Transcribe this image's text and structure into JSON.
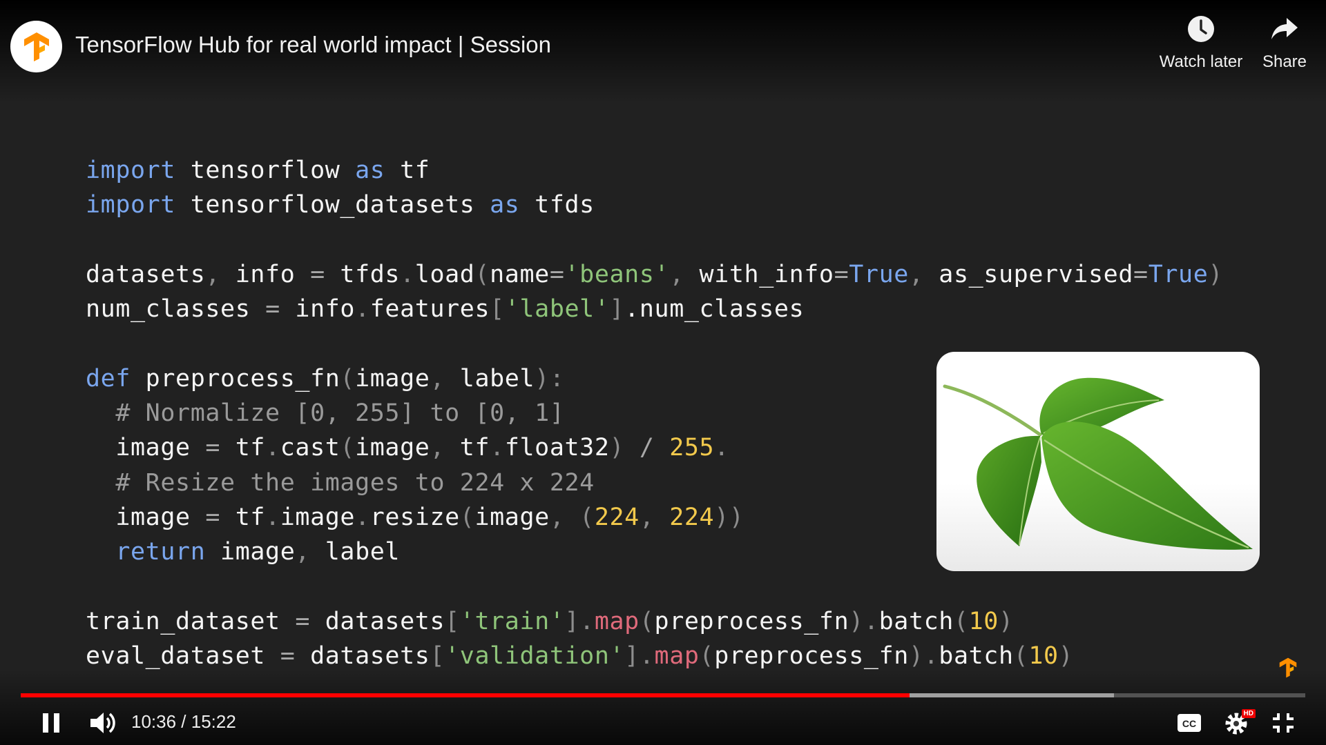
{
  "header": {
    "title": "TensorFlow Hub for real world impact | Session",
    "watch_later_label": "Watch later",
    "share_label": "Share"
  },
  "code_lines": [
    [
      {
        "t": "import",
        "c": "kw"
      },
      {
        "t": " tensorflow "
      },
      {
        "t": "as",
        "c": "kw"
      },
      {
        "t": " tf"
      }
    ],
    [
      {
        "t": "import",
        "c": "kw"
      },
      {
        "t": " tensorflow_datasets "
      },
      {
        "t": "as",
        "c": "kw"
      },
      {
        "t": " tfds"
      }
    ],
    [],
    [
      {
        "t": "datasets"
      },
      {
        "t": ",",
        "c": "pu"
      },
      {
        "t": " info "
      },
      {
        "t": "=",
        "c": "op"
      },
      {
        "t": " tfds"
      },
      {
        "t": ".",
        "c": "pu"
      },
      {
        "t": "load"
      },
      {
        "t": "(",
        "c": "pu"
      },
      {
        "t": "name"
      },
      {
        "t": "=",
        "c": "op"
      },
      {
        "t": "'beans'",
        "c": "str"
      },
      {
        "t": ",",
        "c": "pu"
      },
      {
        "t": " with_info"
      },
      {
        "t": "=",
        "c": "op"
      },
      {
        "t": "True",
        "c": "kw"
      },
      {
        "t": ",",
        "c": "pu"
      },
      {
        "t": " as_supervised"
      },
      {
        "t": "=",
        "c": "op"
      },
      {
        "t": "True",
        "c": "kw"
      },
      {
        "t": ")",
        "c": "pu"
      }
    ],
    [
      {
        "t": "num_classes "
      },
      {
        "t": "=",
        "c": "op"
      },
      {
        "t": " info"
      },
      {
        "t": ".",
        "c": "pu"
      },
      {
        "t": "features"
      },
      {
        "t": "[",
        "c": "pu"
      },
      {
        "t": "'label'",
        "c": "str"
      },
      {
        "t": "]",
        "c": "pu"
      },
      {
        "t": "."
      },
      {
        "t": "num_classes"
      }
    ],
    [],
    [
      {
        "t": "def",
        "c": "kw"
      },
      {
        "t": " preprocess_fn"
      },
      {
        "t": "(",
        "c": "pu"
      },
      {
        "t": "image"
      },
      {
        "t": ",",
        "c": "pu"
      },
      {
        "t": " label"
      },
      {
        "t": "):",
        "c": "pu"
      }
    ],
    [
      {
        "t": "  "
      },
      {
        "t": "# Normalize [0, 255] to [0, 1]",
        "c": "cm"
      }
    ],
    [
      {
        "t": "  image "
      },
      {
        "t": "=",
        "c": "op"
      },
      {
        "t": " tf"
      },
      {
        "t": ".",
        "c": "pu"
      },
      {
        "t": "cast"
      },
      {
        "t": "(",
        "c": "pu"
      },
      {
        "t": "image"
      },
      {
        "t": ",",
        "c": "pu"
      },
      {
        "t": " tf"
      },
      {
        "t": ".",
        "c": "pu"
      },
      {
        "t": "float32"
      },
      {
        "t": ")",
        "c": "pu"
      },
      {
        "t": " / ",
        "c": "op"
      },
      {
        "t": "255",
        "c": "num"
      },
      {
        "t": ".",
        "c": "pu"
      }
    ],
    [
      {
        "t": "  "
      },
      {
        "t": "# Resize the images to 224 x 224",
        "c": "cm"
      }
    ],
    [
      {
        "t": "  image "
      },
      {
        "t": "=",
        "c": "op"
      },
      {
        "t": " tf"
      },
      {
        "t": ".",
        "c": "pu"
      },
      {
        "t": "image"
      },
      {
        "t": ".",
        "c": "pu"
      },
      {
        "t": "resize"
      },
      {
        "t": "(",
        "c": "pu"
      },
      {
        "t": "image"
      },
      {
        "t": ",",
        "c": "pu"
      },
      {
        "t": " "
      },
      {
        "t": "(",
        "c": "pu"
      },
      {
        "t": "224",
        "c": "num"
      },
      {
        "t": ",",
        "c": "pu"
      },
      {
        "t": " "
      },
      {
        "t": "224",
        "c": "num"
      },
      {
        "t": "))",
        "c": "pu"
      }
    ],
    [
      {
        "t": "  "
      },
      {
        "t": "return",
        "c": "kw"
      },
      {
        "t": " image"
      },
      {
        "t": ",",
        "c": "pu"
      },
      {
        "t": " label"
      }
    ],
    [],
    [
      {
        "t": "train_dataset "
      },
      {
        "t": "=",
        "c": "op"
      },
      {
        "t": " datasets"
      },
      {
        "t": "[",
        "c": "pu"
      },
      {
        "t": "'train'",
        "c": "str"
      },
      {
        "t": "]",
        "c": "pu"
      },
      {
        "t": ".",
        "c": "pu"
      },
      {
        "t": "map",
        "c": "mp"
      },
      {
        "t": "(",
        "c": "pu"
      },
      {
        "t": "preprocess_fn"
      },
      {
        "t": ")",
        "c": "pu"
      },
      {
        "t": ".",
        "c": "pu"
      },
      {
        "t": "batch"
      },
      {
        "t": "(",
        "c": "pu"
      },
      {
        "t": "10",
        "c": "num"
      },
      {
        "t": ")",
        "c": "pu"
      }
    ],
    [
      {
        "t": "eval_dataset "
      },
      {
        "t": "=",
        "c": "op"
      },
      {
        "t": " datasets"
      },
      {
        "t": "[",
        "c": "pu"
      },
      {
        "t": "'validation'",
        "c": "str"
      },
      {
        "t": "]",
        "c": "pu"
      },
      {
        "t": ".",
        "c": "pu"
      },
      {
        "t": "map",
        "c": "mp"
      },
      {
        "t": "(",
        "c": "pu"
      },
      {
        "t": "preprocess_fn"
      },
      {
        "t": ")",
        "c": "pu"
      },
      {
        "t": ".",
        "c": "pu"
      },
      {
        "t": "batch"
      },
      {
        "t": "(",
        "c": "pu"
      },
      {
        "t": "10",
        "c": "num"
      },
      {
        "t": ")",
        "c": "pu"
      }
    ]
  ],
  "player": {
    "current_time": "10:36",
    "separator": " / ",
    "duration": "15:22",
    "played_fraction": 0.692,
    "buffered_fraction": 0.851,
    "hd_badge": "HD"
  },
  "icons": {
    "channel_avatar": "tensorflow-logo-icon",
    "watch_later": "clock-icon",
    "share": "share-arrow-icon",
    "play_pause": "pause-icon",
    "volume": "volume-icon",
    "captions": "cc-icon",
    "settings": "gear-icon",
    "fullscreen": "exit-fullscreen-icon"
  },
  "colors": {
    "background": "#212121",
    "progress_played": "#ff0000",
    "tensorflow_orange": "#ff8f00",
    "keyword": "#7aa6ee",
    "string": "#8fc57a",
    "number": "#f2c94c",
    "comment": "#9a9a9a",
    "map_method": "#e06a7b"
  }
}
